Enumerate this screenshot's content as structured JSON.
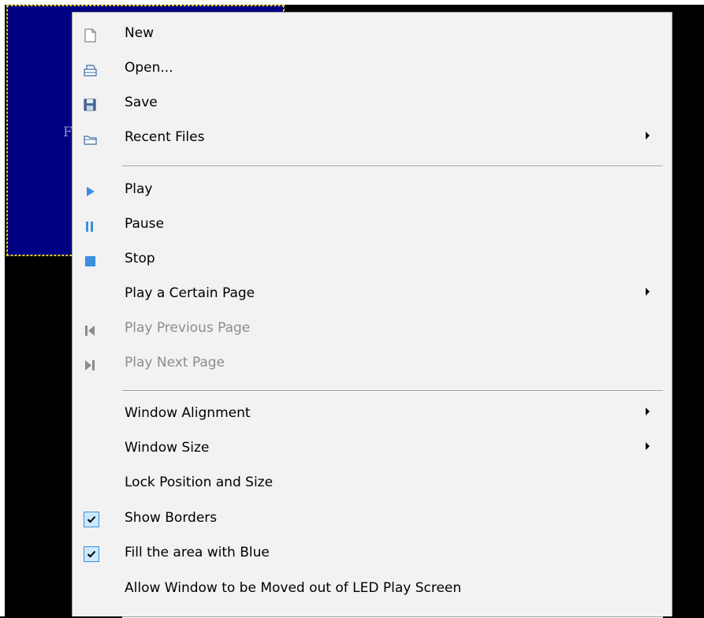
{
  "background_window": {
    "text": "F"
  },
  "menu": {
    "groups": [
      {
        "items": [
          {
            "label": "New",
            "icon": "new-file-icon",
            "submenu": false,
            "disabled": false
          },
          {
            "label": "Open...",
            "icon": "open-icon",
            "submenu": false,
            "disabled": false
          },
          {
            "label": "Save",
            "icon": "save-icon",
            "submenu": false,
            "disabled": false
          },
          {
            "label": "Recent Files",
            "icon": "folder-icon",
            "submenu": true,
            "disabled": false
          }
        ]
      },
      {
        "items": [
          {
            "label": "Play",
            "icon": "play-icon",
            "submenu": false,
            "disabled": false
          },
          {
            "label": "Pause",
            "icon": "pause-icon",
            "submenu": false,
            "disabled": false
          },
          {
            "label": "Stop",
            "icon": "stop-icon",
            "submenu": false,
            "disabled": false
          },
          {
            "label": "Play a Certain Page",
            "icon": "",
            "submenu": true,
            "disabled": false
          },
          {
            "label": "Play Previous Page",
            "icon": "previous-page-icon",
            "submenu": false,
            "disabled": true
          },
          {
            "label": "Play Next Page",
            "icon": "next-page-icon",
            "submenu": false,
            "disabled": true
          }
        ]
      },
      {
        "items": [
          {
            "label": "Window Alignment",
            "icon": "",
            "submenu": true,
            "disabled": false
          },
          {
            "label": "Window Size",
            "icon": "",
            "submenu": true,
            "disabled": false
          },
          {
            "label": "Lock Position and Size",
            "icon": "",
            "submenu": false,
            "disabled": false
          },
          {
            "label": "Show Borders",
            "icon": "check-icon",
            "checked": true,
            "submenu": false,
            "disabled": false
          },
          {
            "label": "Fill the area with Blue",
            "icon": "check-icon",
            "checked": true,
            "submenu": false,
            "disabled": false
          },
          {
            "label": "Allow Window to be Moved out of LED Play Screen",
            "icon": "",
            "submenu": false,
            "disabled": false
          }
        ]
      }
    ]
  },
  "colors": {
    "accent_blue": "#3c8ede",
    "window_fill": "#000083",
    "disabled_icon": "#8c8c8c"
  }
}
